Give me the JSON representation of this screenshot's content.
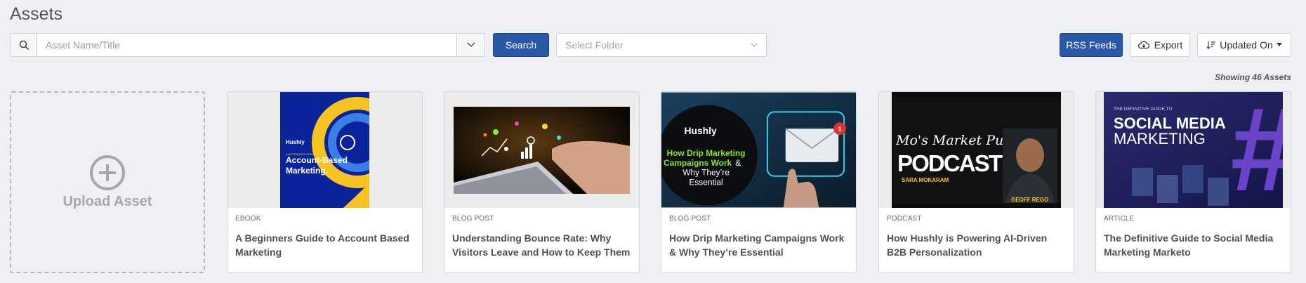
{
  "page": {
    "title": "Assets"
  },
  "search": {
    "placeholder": "Asset Name/Title",
    "button_label": "Search"
  },
  "folder": {
    "placeholder": "Select Folder"
  },
  "toolbar": {
    "rss_label": "RSS Feeds",
    "export_label": "Export",
    "sort_label": "Updated On"
  },
  "summary": {
    "showing": "Showing 46 Assets"
  },
  "upload": {
    "label": "Upload Asset"
  },
  "colors": {
    "primary": "#2a58a8",
    "background": "#eef0f4"
  },
  "assets": [
    {
      "type": "EBOOK",
      "title": "A Beginners Guide to Account Based Marketing",
      "thumb": {
        "brand": "Hushly",
        "kicker": "A BEGINNER'S GUIDE TO",
        "headline1": "Account-Based",
        "headline2": "Marketing."
      }
    },
    {
      "type": "BLOG POST",
      "title": "Understanding Bounce Rate: Why Visitors Leave and How to Keep Them",
      "thumb": {}
    },
    {
      "type": "BLOG POST",
      "title": "How Drip Marketing Campaigns Work & Why They’re Essential",
      "thumb": {
        "brand": "Hushly",
        "line1": "How Drip Marketing",
        "line2": "Campaigns Work",
        "line3": "&",
        "line4": "Why They’re",
        "line5": "Essential",
        "badge": "1"
      }
    },
    {
      "type": "PODCAST",
      "title": "How Hushly is Powering AI-Driven B2B Personalization",
      "thumb": {
        "show1": "Mo's Market Pulse",
        "show2": "PODCAST",
        "host": "SARA MOKARAM",
        "guest": "GEOFF REGO"
      }
    },
    {
      "type": "ARTICLE",
      "title": "The Definitive Guide to Social Media Marketing Marketo",
      "thumb": {
        "kicker": "THE DEFINITIVE GUIDE TO",
        "line1": "SOCIAL MEDIA",
        "line2": "MARKETING",
        "symbol": "#"
      }
    }
  ]
}
